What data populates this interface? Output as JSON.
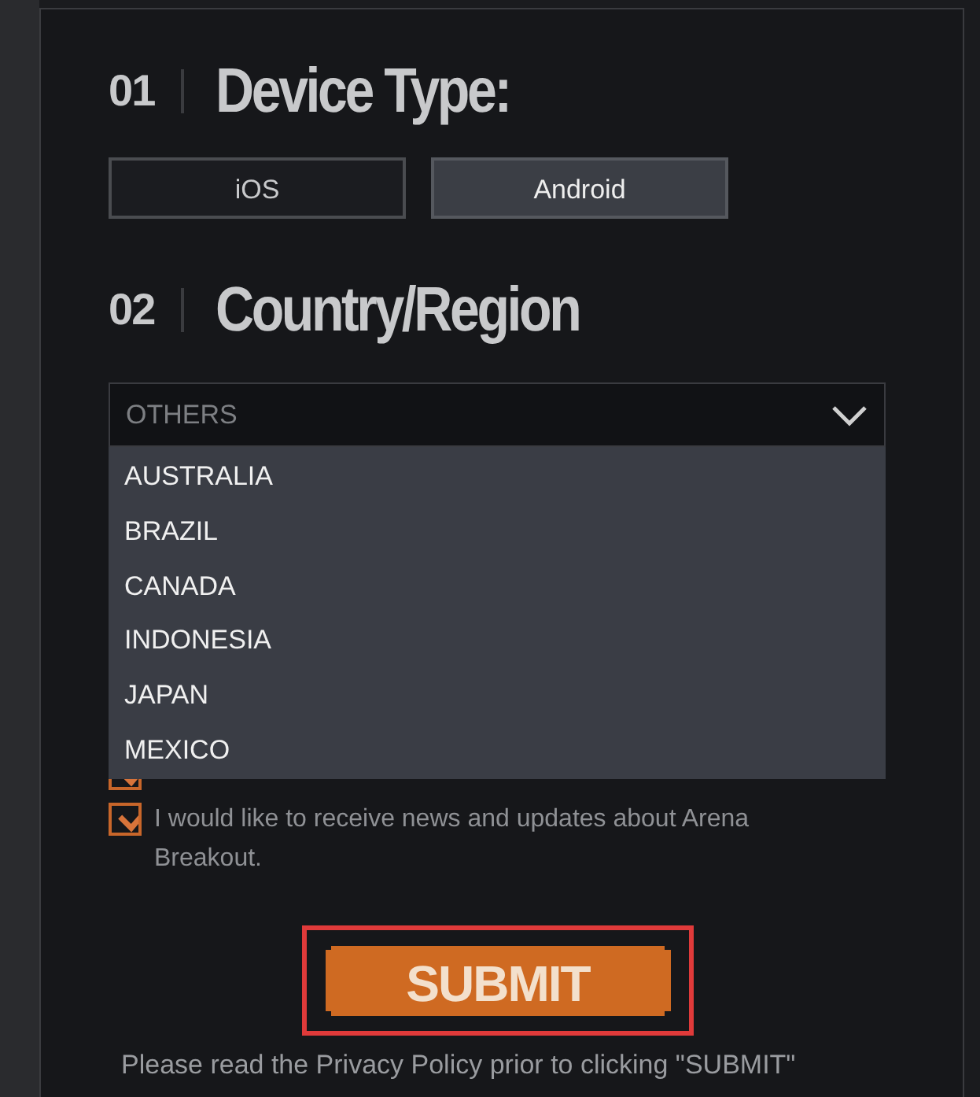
{
  "sections": [
    {
      "number": "01",
      "title": "Device Type:"
    },
    {
      "number": "02",
      "title": "Country/Region"
    }
  ],
  "device_options": [
    {
      "label": "iOS",
      "selected": false
    },
    {
      "label": "Android",
      "selected": true
    }
  ],
  "region_select": {
    "value": "OTHERS",
    "expanded": true,
    "options": [
      "AUSTRALIA",
      "BRAZIL",
      "CANADA",
      "INDONESIA",
      "JAPAN",
      "MEXICO"
    ]
  },
  "checkboxes": [
    {
      "checked": true
    },
    {
      "checked": true,
      "label": "I would like to receive news and updates about Arena Breakout."
    }
  ],
  "submit": {
    "label": "SUBMIT",
    "highlighted": true
  },
  "footer_note": "Please read the Privacy Policy prior to clicking \"SUBMIT\""
}
